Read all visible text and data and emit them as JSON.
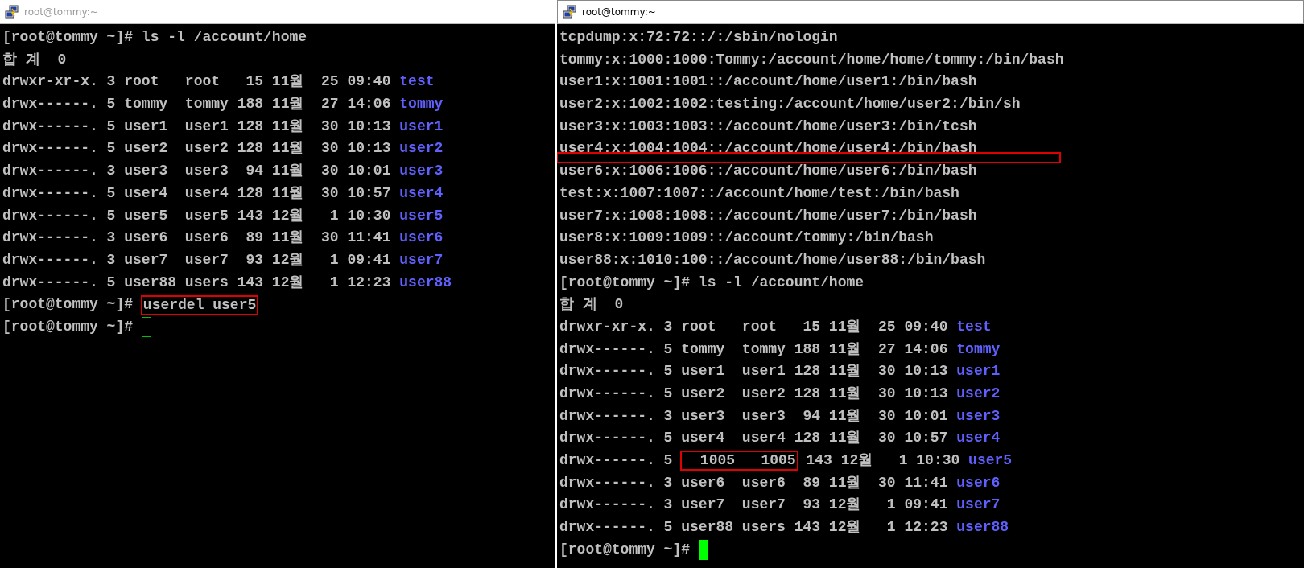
{
  "windows": [
    {
      "title": "root@tommy:~",
      "active": false,
      "lines": [
        {
          "segments": [
            {
              "text": "[root@tommy ~]# ls -l /account/home",
              "kind": "text"
            }
          ]
        },
        {
          "segments": [
            {
              "text": "합 계  0",
              "kind": "text"
            }
          ]
        },
        {
          "segments": [
            {
              "text": "drwxr-xr-x. 3 root   root   15 11월  25 09:40 ",
              "kind": "text"
            },
            {
              "text": "test",
              "kind": "directory"
            }
          ]
        },
        {
          "segments": [
            {
              "text": "drwx------. 5 tommy  tommy 188 11월  27 14:06 ",
              "kind": "text"
            },
            {
              "text": "tommy",
              "kind": "directory"
            }
          ]
        },
        {
          "segments": [
            {
              "text": "drwx------. 5 user1  user1 128 11월  30 10:13 ",
              "kind": "text"
            },
            {
              "text": "user1",
              "kind": "directory"
            }
          ]
        },
        {
          "segments": [
            {
              "text": "drwx------. 5 user2  user2 128 11월  30 10:13 ",
              "kind": "text"
            },
            {
              "text": "user2",
              "kind": "directory"
            }
          ]
        },
        {
          "segments": [
            {
              "text": "drwx------. 3 user3  user3  94 11월  30 10:01 ",
              "kind": "text"
            },
            {
              "text": "user3",
              "kind": "directory"
            }
          ]
        },
        {
          "segments": [
            {
              "text": "drwx------. 5 user4  user4 128 11월  30 10:57 ",
              "kind": "text"
            },
            {
              "text": "user4",
              "kind": "directory"
            }
          ]
        },
        {
          "segments": [
            {
              "text": "drwx------. 5 user5  user5 143 12월   1 10:30 ",
              "kind": "text"
            },
            {
              "text": "user5",
              "kind": "directory"
            }
          ]
        },
        {
          "segments": [
            {
              "text": "drwx------. 3 user6  user6  89 11월  30 11:41 ",
              "kind": "text"
            },
            {
              "text": "user6",
              "kind": "directory"
            }
          ]
        },
        {
          "segments": [
            {
              "text": "drwx------. 3 user7  user7  93 12월   1 09:41 ",
              "kind": "text"
            },
            {
              "text": "user7",
              "kind": "directory"
            }
          ]
        },
        {
          "segments": [
            {
              "text": "drwx------. 5 user88 users 143 12월   1 12:23 ",
              "kind": "text"
            },
            {
              "text": "user88",
              "kind": "directory"
            }
          ]
        },
        {
          "segments": [
            {
              "text": "[root@tommy ~]# ",
              "kind": "text"
            },
            {
              "text": "userdel user5",
              "kind": "boxed"
            }
          ]
        },
        {
          "segments": [
            {
              "text": "[root@tommy ~]# ",
              "kind": "text"
            }
          ],
          "cursor": true
        }
      ]
    },
    {
      "title": "root@tommy:~",
      "active": true,
      "lines": [
        {
          "segments": [
            {
              "text": "tcpdump:x:72:72::/:/sbin/nologin",
              "kind": "text"
            }
          ]
        },
        {
          "segments": [
            {
              "text": "tommy:x:1000:1000:Tommy:/account/home/home/tommy:/bin/bash",
              "kind": "text"
            }
          ]
        },
        {
          "segments": [
            {
              "text": "user1:x:1001:1001::/account/home/user1:/bin/bash",
              "kind": "text"
            }
          ]
        },
        {
          "segments": [
            {
              "text": "user2:x:1002:1002:testing:/account/home/user2:/bin/sh",
              "kind": "text"
            }
          ]
        },
        {
          "segments": [
            {
              "text": "user3:x:1003:1003::/account/home/user3:/bin/tcsh",
              "kind": "text"
            }
          ]
        },
        {
          "segments": [
            {
              "text": "user4:x:1004:1004::/account/home/user4:/bin/bash",
              "kind": "text"
            }
          ],
          "gap_box": true
        },
        {
          "segments": [
            {
              "text": "user6:x:1006:1006::/account/home/user6:/bin/bash",
              "kind": "text"
            }
          ]
        },
        {
          "segments": [
            {
              "text": "test:x:1007:1007::/account/home/test:/bin/bash",
              "kind": "text"
            }
          ]
        },
        {
          "segments": [
            {
              "text": "user7:x:1008:1008::/account/home/user7:/bin/bash",
              "kind": "text"
            }
          ]
        },
        {
          "segments": [
            {
              "text": "user8:x:1009:1009::/account/tommy:/bin/bash",
              "kind": "text"
            }
          ]
        },
        {
          "segments": [
            {
              "text": "user88:x:1010:100::/account/home/user88:/bin/bash",
              "kind": "text"
            }
          ]
        },
        {
          "segments": [
            {
              "text": "[root@tommy ~]# ls -l /account/home",
              "kind": "text"
            }
          ]
        },
        {
          "segments": [
            {
              "text": "합 계  0",
              "kind": "text"
            }
          ]
        },
        {
          "segments": [
            {
              "text": "drwxr-xr-x. 3 root   root   15 11월  25 09:40 ",
              "kind": "text"
            },
            {
              "text": "test",
              "kind": "directory"
            }
          ]
        },
        {
          "segments": [
            {
              "text": "drwx------. 5 tommy  tommy 188 11월  27 14:06 ",
              "kind": "text"
            },
            {
              "text": "tommy",
              "kind": "directory"
            }
          ]
        },
        {
          "segments": [
            {
              "text": "drwx------. 5 user1  user1 128 11월  30 10:13 ",
              "kind": "text"
            },
            {
              "text": "user1",
              "kind": "directory"
            }
          ]
        },
        {
          "segments": [
            {
              "text": "drwx------. 5 user2  user2 128 11월  30 10:13 ",
              "kind": "text"
            },
            {
              "text": "user2",
              "kind": "directory"
            }
          ]
        },
        {
          "segments": [
            {
              "text": "drwx------. 3 user3  user3  94 11월  30 10:01 ",
              "kind": "text"
            },
            {
              "text": "user3",
              "kind": "directory"
            }
          ]
        },
        {
          "segments": [
            {
              "text": "drwx------. 5 user4  user4 128 11월  30 10:57 ",
              "kind": "text"
            },
            {
              "text": "user4",
              "kind": "directory"
            }
          ]
        },
        {
          "segments": [
            {
              "text": "drwx------. 5 ",
              "kind": "text"
            },
            {
              "text": "  1005   1005",
              "kind": "boxed"
            },
            {
              "text": " 143 12월   1 10:30 ",
              "kind": "text"
            },
            {
              "text": "user5",
              "kind": "directory"
            }
          ]
        },
        {
          "segments": [
            {
              "text": "drwx------. 3 user6  user6  89 11월  30 11:41 ",
              "kind": "text"
            },
            {
              "text": "user6",
              "kind": "directory"
            }
          ]
        },
        {
          "segments": [
            {
              "text": "drwx------. 3 user7  user7  93 12월   1 09:41 ",
              "kind": "text"
            },
            {
              "text": "user7",
              "kind": "directory"
            }
          ]
        },
        {
          "segments": [
            {
              "text": "drwx------. 5 user88 users 143 12월   1 12:23 ",
              "kind": "text"
            },
            {
              "text": "user88",
              "kind": "directory"
            }
          ]
        },
        {
          "segments": [
            {
              "text": "[root@tommy ~]# ",
              "kind": "text"
            }
          ],
          "cursor": true
        }
      ]
    }
  ]
}
